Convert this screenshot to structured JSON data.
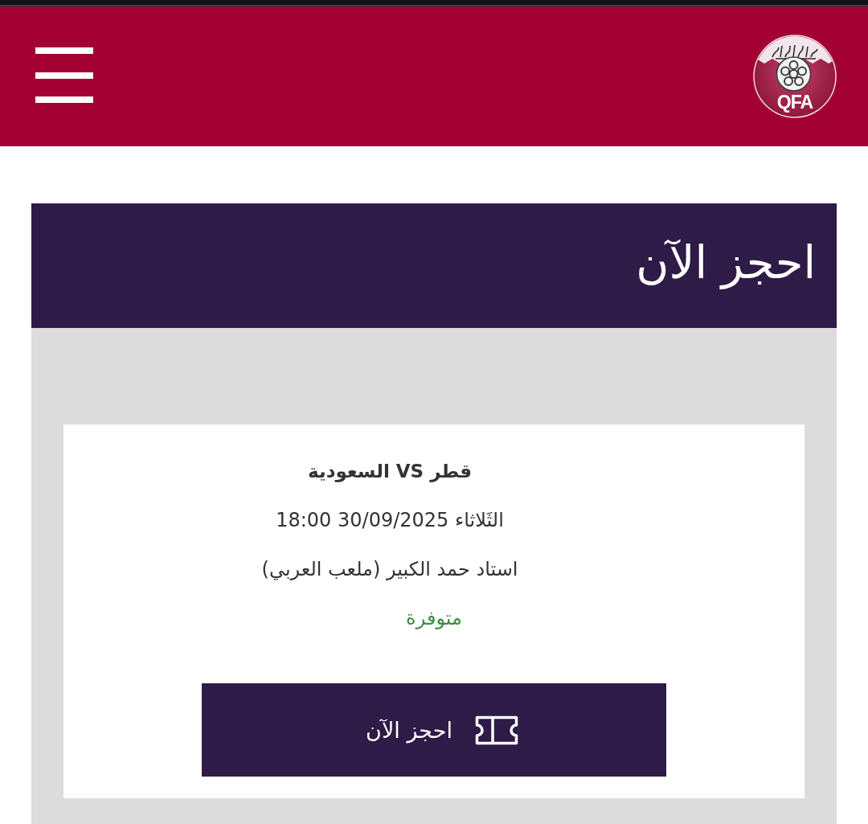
{
  "header": {
    "logo": {
      "text": "QFA"
    }
  },
  "booking": {
    "title": "احجز الآن",
    "match": {
      "title": "قطر VS السعودية",
      "datetime": "الثَلاثاء 30/09/2025 18:00",
      "venue": "استاد حمد الكبير (ملعب العربي)",
      "status": {
        "text": "متوفرة",
        "kind": "available"
      }
    },
    "button": {
      "label": "احجز الآن"
    }
  }
}
